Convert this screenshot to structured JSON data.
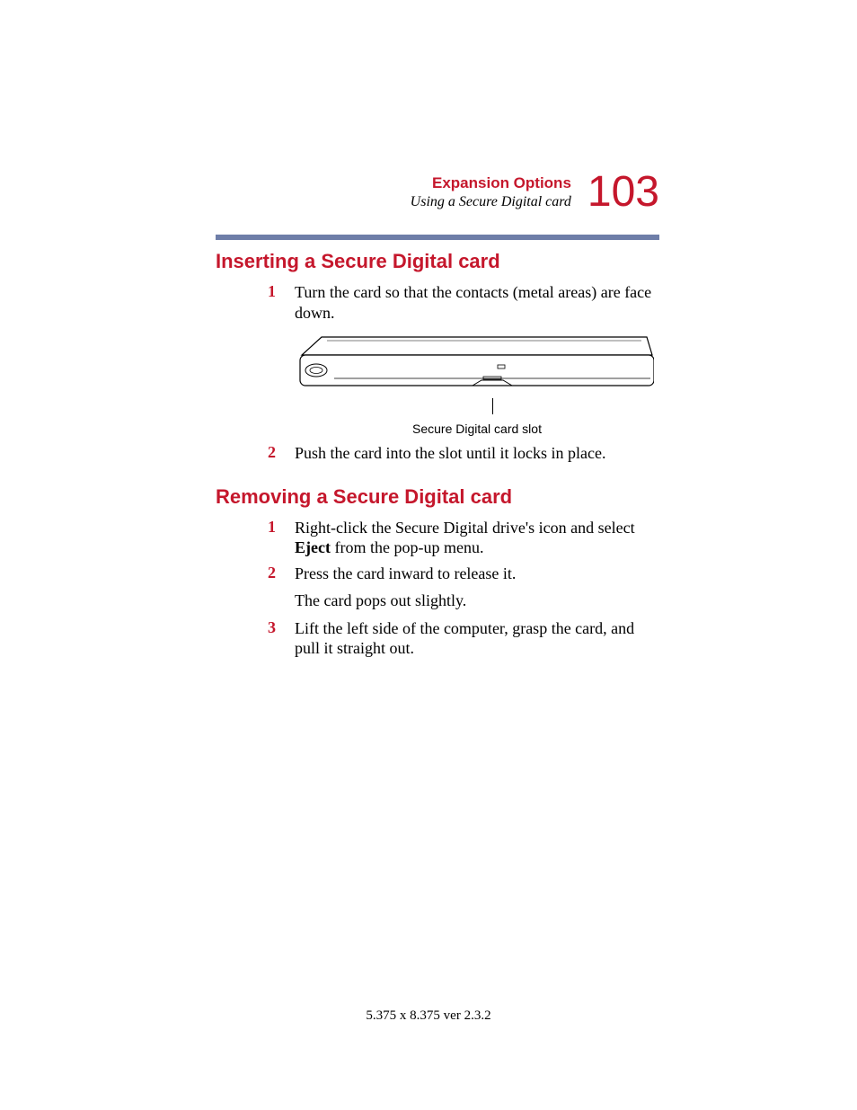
{
  "header": {
    "chapter": "Expansion Options",
    "subtitle": "Using a Secure Digital card",
    "page_number": "103"
  },
  "sections": {
    "inserting": {
      "heading": "Inserting a Secure Digital card",
      "step1_num": "1",
      "step1_text": "Turn the card so that the contacts (metal areas) are face down.",
      "caption": "Secure Digital card slot",
      "step2_num": "2",
      "step2_text": "Push the card into the slot until it locks in place."
    },
    "removing": {
      "heading": "Removing a Secure Digital card",
      "step1_num": "1",
      "step1_text_a": "Right-click the Secure Digital drive's icon and select ",
      "step1_bold": "Eject",
      "step1_text_b": " from the pop-up menu.",
      "step2_num": "2",
      "step2_text": " Press the card inward to release it.",
      "cont": "The card pops out slightly.",
      "step3_num": "3",
      "step3_text": "Lift the left side of the computer, grasp the card, and pull it straight out."
    }
  },
  "footer": "5.375 x 8.375 ver 2.3.2",
  "colors": {
    "accent": "#c5172c",
    "divider": "#6e7ea8"
  }
}
